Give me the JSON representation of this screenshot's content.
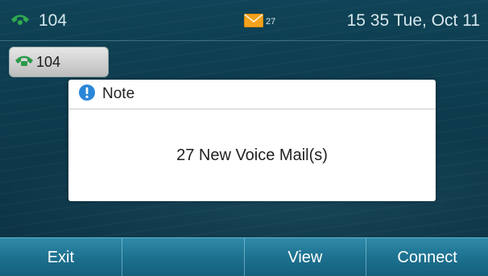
{
  "statusbar": {
    "account": "104",
    "voicemail_count": "27",
    "datetime": "15 35 Tue, Oct 11"
  },
  "line_key": {
    "label": "104"
  },
  "dialog": {
    "title": "Note",
    "message": "27 New Voice Mail(s)"
  },
  "softkeys": [
    {
      "label": "Exit"
    },
    {
      "label": ""
    },
    {
      "label": "View"
    },
    {
      "label": "Connect"
    }
  ],
  "icons": {
    "status_phone": "phone-handset-icon",
    "voicemail": "envelope-icon",
    "line_phone": "phone-handset-icon",
    "note": "info-icon"
  },
  "colors": {
    "accent_green": "#2faa4f",
    "softkey_blue": "#1b6f8d",
    "info_blue": "#2a86d8",
    "envelope_orange": "#f3a21d"
  }
}
